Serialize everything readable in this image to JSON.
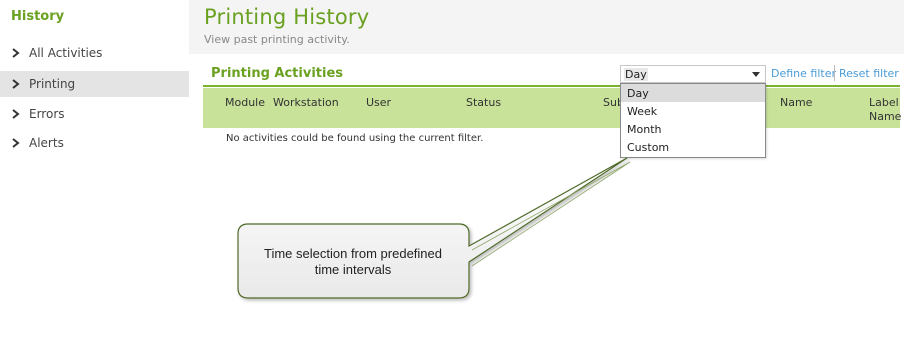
{
  "sidebar": {
    "title": "History",
    "items": [
      {
        "label": "All Activities"
      },
      {
        "label": "Printing"
      },
      {
        "label": "Errors"
      },
      {
        "label": "Alerts"
      }
    ]
  },
  "header": {
    "title": "Printing History",
    "subtitle": "View past printing activity."
  },
  "section": {
    "title": "Printing Activities"
  },
  "filter": {
    "selected": "Day",
    "options": [
      "Day",
      "Week",
      "Month",
      "Custom"
    ],
    "define_filter": "Define filter",
    "reset_filter": "Reset filter"
  },
  "table": {
    "columns": [
      "Module",
      "Workstation",
      "User",
      "Status",
      "Sub",
      "Name",
      "Label",
      "Name"
    ],
    "empty_message": "No activities could be found using the current filter."
  },
  "callout": {
    "text_line1": "Time selection from predefined",
    "text_line2": "time intervals"
  },
  "colors": {
    "accent": "#6aa121",
    "table_header": "#c9e29a",
    "link": "#4a9bd6"
  }
}
